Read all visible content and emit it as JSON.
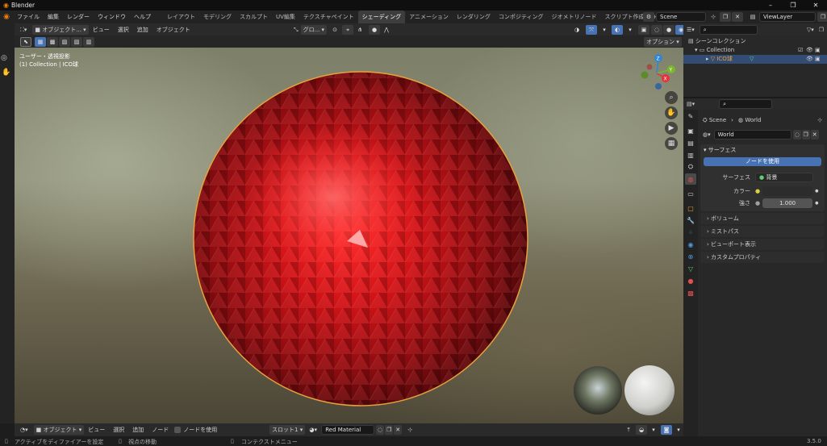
{
  "window": {
    "title": "Blender",
    "min": "–",
    "max": "❐",
    "close": "✕"
  },
  "menu": [
    "ファイル",
    "編集",
    "レンダー",
    "ウィンドウ",
    "ヘルプ"
  ],
  "workspaces": [
    "レイアウト",
    "モデリング",
    "スカルプト",
    "UV編集",
    "テクスチャペイント",
    "シェーディング",
    "アニメーション",
    "レンダリング",
    "コンポジティング",
    "ジオメトリノード",
    "スクリプト作成"
  ],
  "workspace_active": "シェーディング",
  "add_tab": "+",
  "scene": {
    "name": "Scene"
  },
  "view_layer": {
    "name": "ViewLayer"
  },
  "viewport": {
    "mode": "オブジェクト...",
    "menus": [
      "ビュー",
      "選択",
      "追加",
      "オブジェクト"
    ],
    "transform": "グロ...",
    "options": "オプション",
    "overlay_title": "ユーザー・透視投影",
    "overlay_sub": "(1) Collection | ICO球",
    "axis": {
      "z": "Z",
      "y": "Y",
      "x": "X"
    },
    "accent": {
      "x": "#e8323b",
      "y": "#7bb62b",
      "z": "#2f86d6",
      "rim": "#e8a23c",
      "sphere": "#c0141a"
    }
  },
  "outliner": {
    "root": "シーンコレクション",
    "collection": "Collection",
    "object": "ICO球"
  },
  "props": {
    "breadcrumb_scene": "Scene",
    "breadcrumb_world": "World",
    "world_name": "World",
    "surface_panel": "サーフェス",
    "use_nodes": "ノードを使用",
    "surface_label": "サーフェス",
    "surface_value": "背景",
    "color_label": "カラー",
    "strength_label": "強さ",
    "strength_value": "1.000",
    "subpanels": [
      "ボリューム",
      "ミストパス",
      "ビューポート表示",
      "カスタムプロパティ"
    ]
  },
  "node_editor": {
    "mode": "オブジェクト",
    "menus": [
      "ビュー",
      "選択",
      "追加",
      "ノード"
    ],
    "use_nodes": "ノードを使用",
    "slot": "スロット1",
    "material": "Red Material"
  },
  "status": {
    "left": "アクティブをディファイアーを設定",
    "mid": "視点の移動",
    "right": "コンテクストメニュー",
    "version": "3.5.0"
  }
}
